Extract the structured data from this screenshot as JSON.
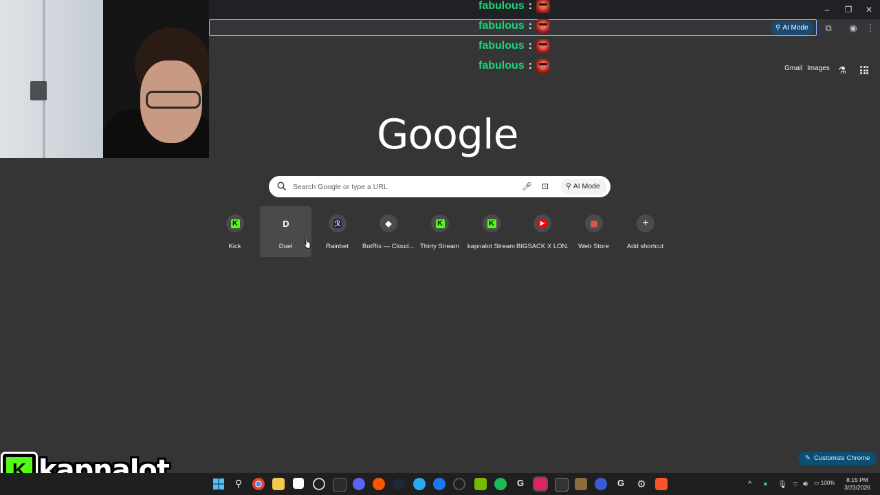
{
  "chat_overlay": {
    "lines": [
      {
        "user": "fabulous",
        "sep": ":"
      },
      {
        "user": "fabulous",
        "sep": ":"
      },
      {
        "user": "fabulous",
        "sep": ":"
      },
      {
        "user": "fabulous",
        "sep": ":"
      }
    ]
  },
  "toolbar": {
    "ai_mode_label": "AI Mode"
  },
  "header_links": {
    "gmail": "Gmail",
    "images": "Images"
  },
  "logo": "Google",
  "search": {
    "placeholder": "Search Google or type a URL",
    "ai_mode_label": "AI Mode"
  },
  "shortcuts": [
    {
      "label": "Kick",
      "icon": "kick-icon",
      "glyph": "K"
    },
    {
      "label": "Duel",
      "icon": "duel-icon",
      "glyph": "D"
    },
    {
      "label": "Rainbet",
      "icon": "rainbet-icon",
      "glyph": "ℛ"
    },
    {
      "label": "BotRix — Cloud...",
      "icon": "botrix-icon",
      "glyph": "◆"
    },
    {
      "label": "Thirty Stream",
      "icon": "kick-icon",
      "glyph": "K"
    },
    {
      "label": "kapnalot Stream",
      "icon": "kick-icon",
      "glyph": "K"
    },
    {
      "label": "BIGSACK X LON...",
      "icon": "youtube-icon",
      "glyph": "▶"
    },
    {
      "label": "Web Store",
      "icon": "webstore-icon",
      "glyph": "▦"
    },
    {
      "label": "Add shortcut",
      "icon": "plus-icon",
      "glyph": "+"
    }
  ],
  "customize": {
    "label": "Customize Chrome"
  },
  "watermark": {
    "text": "kapnalot",
    "k": "K"
  },
  "taskbar": {
    "battery": "100%",
    "time": "8:15 PM",
    "date": "3/23/2026"
  },
  "colors": {
    "background": "#353535",
    "chat_name": "#1ed37a",
    "kick_green": "#53fc18",
    "accent_blue": "#0b4f73"
  }
}
